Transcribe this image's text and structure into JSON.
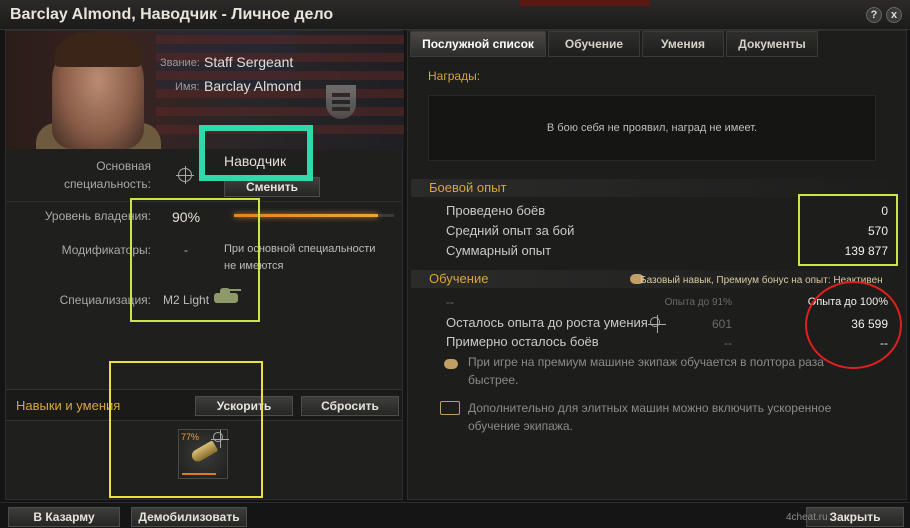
{
  "window": {
    "title": "Barclay Almond, Наводчик - Личное дело",
    "help_label": "?",
    "close_label": "x"
  },
  "profile": {
    "rank_label": "Звание:",
    "rank_value": "Staff Sergeant",
    "name_label": "Имя:",
    "name_value": "Barclay Almond",
    "primary_spec_label_1": "Основная",
    "primary_spec_label_2": "специальность:",
    "primary_spec_value": "Наводчик",
    "change_button": "Сменить",
    "mastery_label": "Уровень владения:",
    "mastery_value": "90%",
    "mastery_level": 0.9,
    "modifiers_label": "Модификаторы:",
    "modifiers_value": "-",
    "modifiers_note_1": "При основной специальности",
    "modifiers_note_2": "не имеются",
    "specialization_label": "Специализация:",
    "specialization_value": "M2 Light"
  },
  "skills": {
    "title": "Навыки и умения",
    "accelerate_button": "Ускорить",
    "reset_button": "Сбросить",
    "tile_percent": "77%",
    "tile_progress": 0.77
  },
  "tabs": [
    {
      "label": "Послужной список",
      "active": true
    },
    {
      "label": "Обучение",
      "active": false
    },
    {
      "label": "Умения",
      "active": false
    },
    {
      "label": "Документы",
      "active": false
    }
  ],
  "awards": {
    "title": "Награды:",
    "empty_text": "В бою себя не проявил, наград не имеет."
  },
  "combat": {
    "title": "Боевой опыт",
    "rows": [
      {
        "label": "Проведено боёв",
        "value": "0"
      },
      {
        "label": "Средний опыт за бой",
        "value": "570"
      },
      {
        "label": "Суммарный опыт",
        "value": "139 877"
      }
    ]
  },
  "training": {
    "title": "Обучение",
    "boost_text": "Базовый навык, Премиум бонус на опыт: Неактивен",
    "row1_label": "--",
    "row1_mid": "Опыта до 91%",
    "row1_right": "Опыта до 100%",
    "row2_label": "Осталось опыта до роста умения",
    "row2_mid": "601",
    "row2_right": "36 599",
    "row3_label": "Примерно осталось боёв",
    "row3_mid": "--",
    "row3_right": "--",
    "note1_a": "При игре на премиум машине экипаж обучается в полтора раза",
    "note1_b": "быстрее.",
    "note2_a": "Дополнительно для элитных машин можно включить ускоренное",
    "note2_b": "обучение экипажа."
  },
  "footer": {
    "barracks_button": "В Казарму",
    "demobilize_button": "Демобилизовать",
    "close_button": "Закрыть",
    "watermark": "4cheat.ru"
  },
  "colors": {
    "accent": "#d8a63a",
    "highlight_green": "#2fd9a9",
    "highlight_yellow": "#e8e23b",
    "highlight_red": "#e01f1f"
  }
}
